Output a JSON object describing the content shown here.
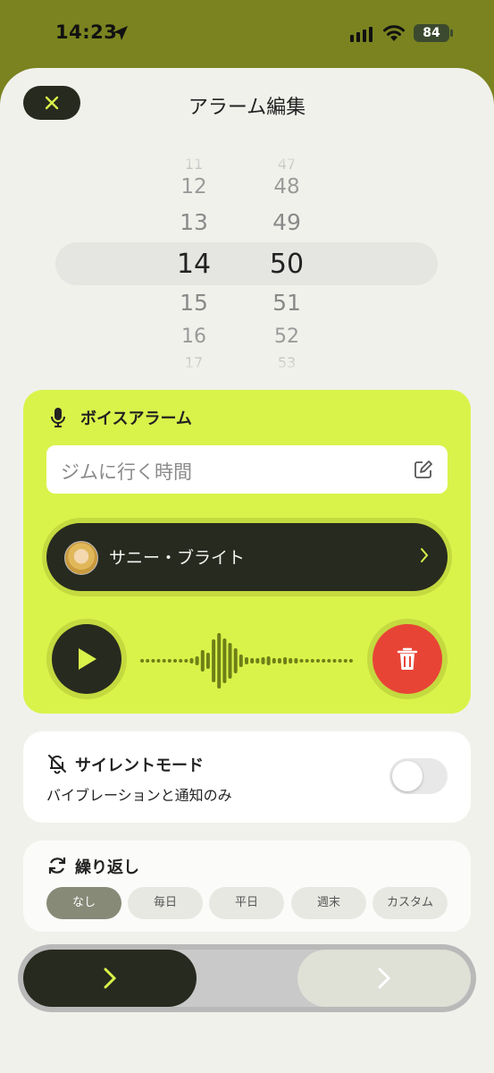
{
  "status_bar": {
    "time": "14:23",
    "battery": "84"
  },
  "header": {
    "title": "アラーム編集",
    "close_icon": "close-icon"
  },
  "picker": {
    "hours": {
      "far_top": "11",
      "above2": "12",
      "above1": "13",
      "selected": "14",
      "below1": "15",
      "below2": "16",
      "far_bottom": "17"
    },
    "minutes": {
      "far_top": "47",
      "above2": "48",
      "above1": "49",
      "selected": "50",
      "below1": "51",
      "below2": "52",
      "far_bottom": "53"
    }
  },
  "voice_alarm": {
    "title": "ボイスアラーム",
    "note_placeholder": "ジムに行く時間",
    "voice_name": "サニー・ブライト",
    "accent_color": "#d9f34a",
    "delete_color": "#e84436"
  },
  "silent_mode": {
    "title": "サイレントモード",
    "subtitle": "バイブレーションと通知のみ",
    "enabled": false
  },
  "repeat": {
    "title": "繰り返し",
    "options": [
      "なし",
      "毎日",
      "平日",
      "週末",
      "カスタム"
    ],
    "selected": "なし"
  },
  "icons": [
    "location-arrow-icon",
    "cellular-signal-icon",
    "wifi-icon",
    "battery-icon",
    "microphone-icon",
    "edit-icon",
    "chevron-right-icon",
    "play-icon",
    "trash-icon",
    "bell-slash-icon",
    "repeat-icon"
  ]
}
